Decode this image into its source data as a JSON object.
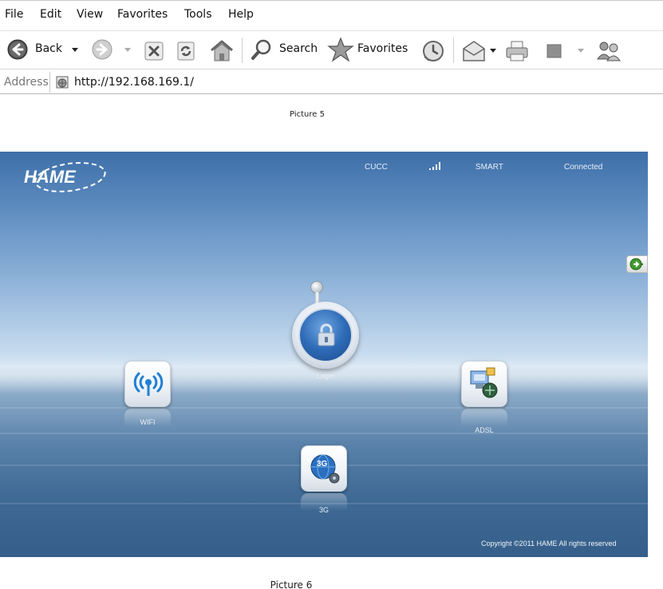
{
  "menu": {
    "items": [
      "File",
      "Edit",
      "View",
      "Favorites",
      "Tools",
      "Help"
    ]
  },
  "toolbar": {
    "back_label": "Back",
    "search_label": "Search",
    "favorites_label": "Favorites",
    "icons": [
      "back-icon",
      "forward-icon",
      "stop-icon",
      "refresh-icon",
      "home-icon",
      "search-icon",
      "favorites-star-icon",
      "history-icon",
      "mail-icon",
      "print-icon",
      "edit-icon",
      "messenger-icon"
    ]
  },
  "address": {
    "label": "Address",
    "url": "http://192.168.169.1/"
  },
  "captions": {
    "picture5": "Picture 5",
    "picture6": "Picture 6"
  },
  "hame": {
    "logo_text": "HAME",
    "status": {
      "carrier": "CUCC",
      "mode": "SMART",
      "connection": "Connected"
    },
    "apps": {
      "login": "Login",
      "wifi": "WIFI",
      "adsl": "ADSL",
      "threeg": "3G",
      "threeg_icon_text": "3G"
    },
    "copyright": "Copyright ©2011 HAME All rights reserved",
    "colors": {
      "sky_top": "#3e6fa8",
      "horizon": "#d9e7f3",
      "sea": "#355f8a"
    }
  }
}
